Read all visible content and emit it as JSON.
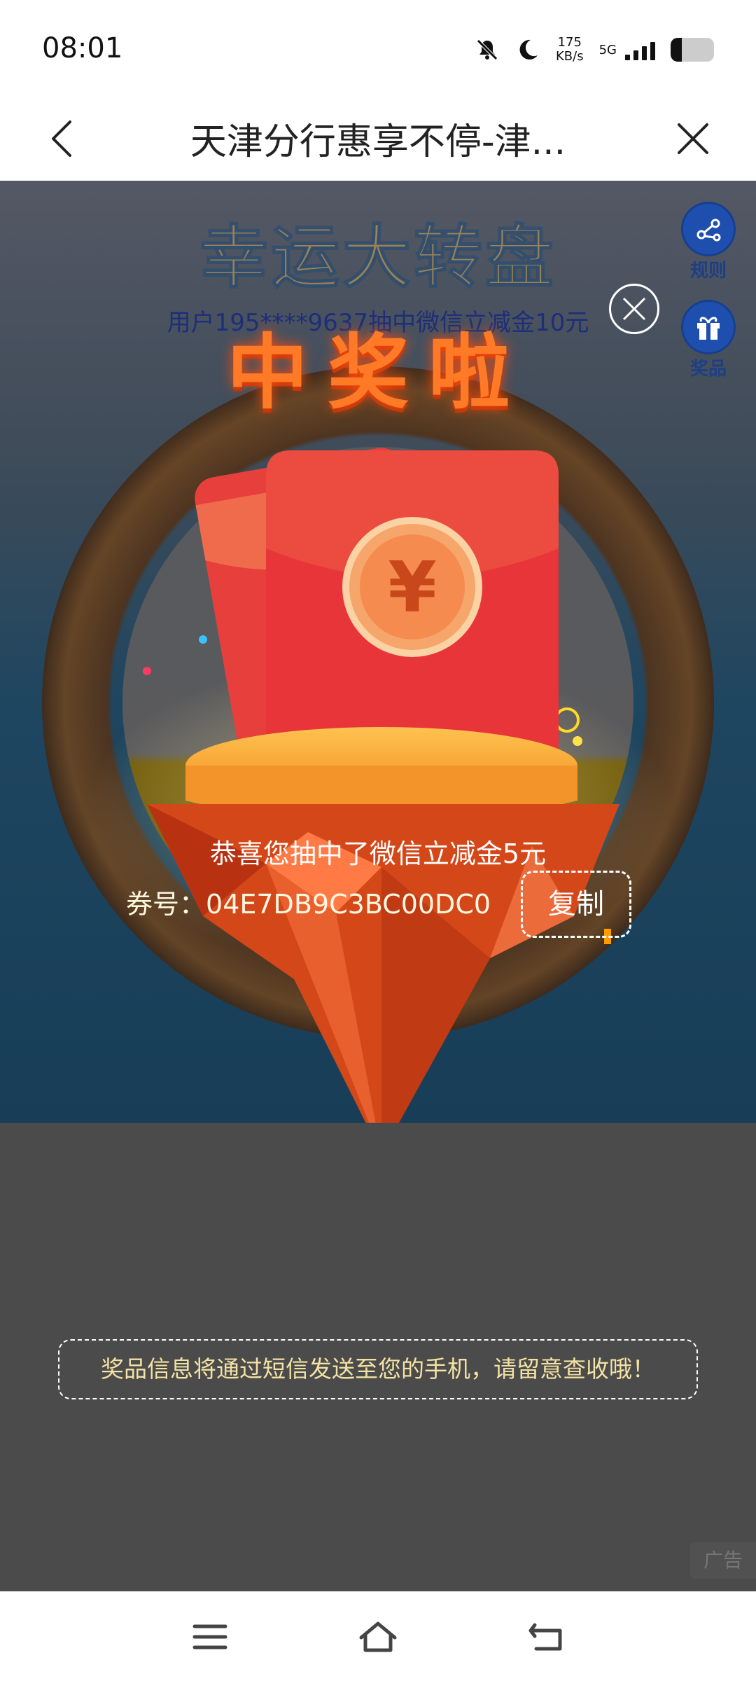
{
  "status_bar": {
    "time": "08:01",
    "speed_value": "175",
    "speed_unit": "KB/s",
    "network": "5G",
    "battery_level": 0.25
  },
  "nav": {
    "title": "天津分行惠享不停-津..."
  },
  "game": {
    "title": "幸运大转盘",
    "marquee": "用户195****9637抽中微信立减金10元",
    "side_buttons": {
      "rules_label": "规则",
      "prizes_label": "奖品"
    }
  },
  "modal": {
    "heading": "中奖啦",
    "envelope_symbol": "¥",
    "congrats_text": "恭喜您抽中了微信立减金5元",
    "coupon_label": "券号：",
    "coupon_code": "04E7DB9C3BC00DC0",
    "copy_label": "复制"
  },
  "notice": {
    "text": "奖品信息将通过短信发送至您的手机，请留意查收哦！"
  },
  "ad": {
    "label": "广告"
  },
  "colors": {
    "envelope_red": "#e8353a",
    "accent_orange": "#ff7a27",
    "notice_text": "#f3e2a3"
  }
}
